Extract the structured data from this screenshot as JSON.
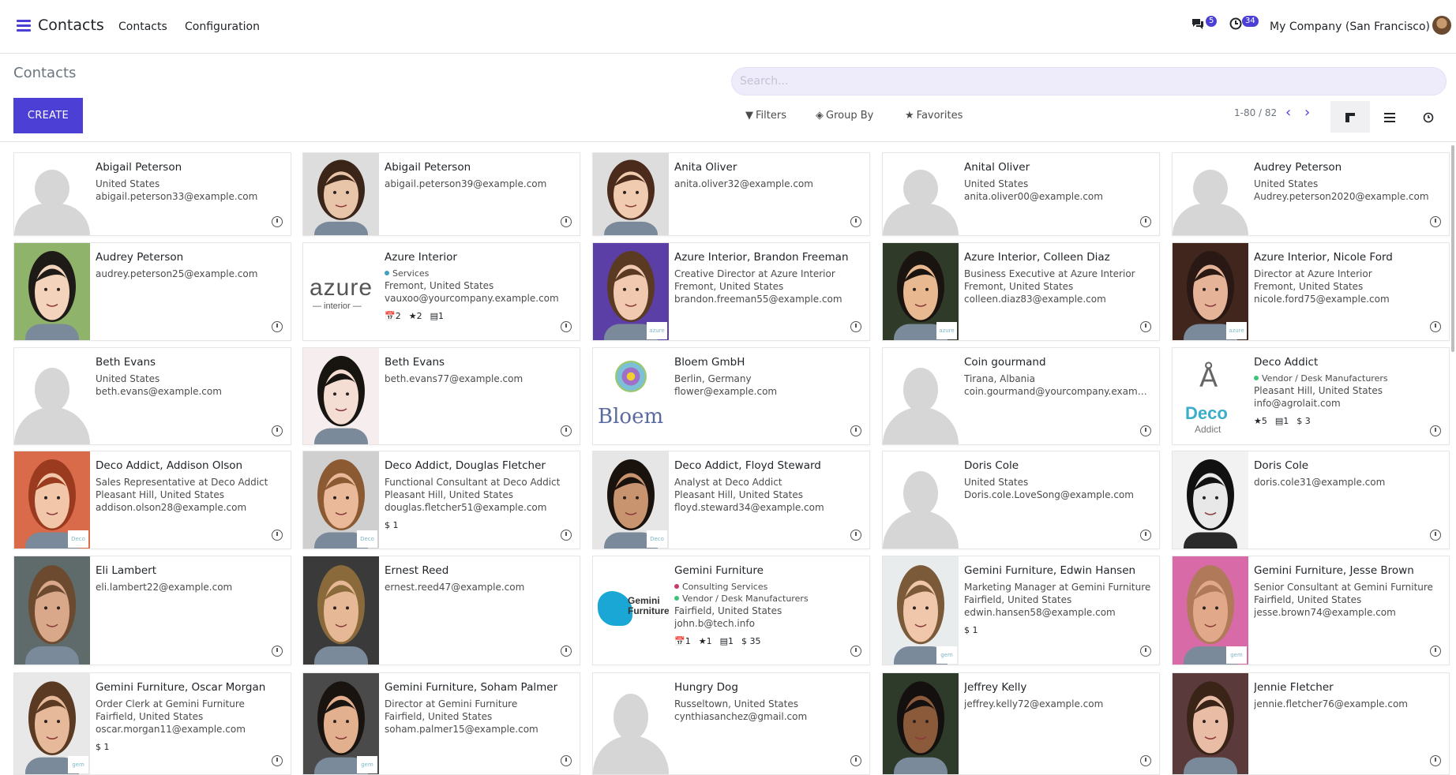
{
  "navbar": {
    "app_name": "Contacts",
    "menu": [
      "Contacts",
      "Configuration"
    ],
    "messages_count": "5",
    "activities_count": "34",
    "company": "My Company (San Francisco)"
  },
  "control_panel": {
    "title": "Contacts",
    "search_placeholder": "Search...",
    "create_label": "CREATE",
    "filters_label": "Filters",
    "groupby_label": "Group By",
    "favorites_label": "Favorites",
    "pager": "1-80 / 82"
  },
  "cards": [
    {
      "name": "Abigail Peterson",
      "lines": [
        "United States",
        "abigail.peterson33@example.com"
      ],
      "photo": "placeholder"
    },
    {
      "name": "Abigail Peterson",
      "lines": [
        "abigail.peterson39@example.com"
      ],
      "photo": "person",
      "skin": "#e8c4a8",
      "hair": "#3b2418"
    },
    {
      "name": "Anita Oliver",
      "lines": [
        "anita.oliver32@example.com"
      ],
      "photo": "person",
      "skin": "#f0cbb0",
      "hair": "#4a2b1c"
    },
    {
      "name": "Anital Oliver",
      "lines": [
        "United States",
        "anita.oliver00@example.com"
      ],
      "photo": "placeholder"
    },
    {
      "name": "Audrey Peterson",
      "lines": [
        "United States",
        "Audrey.peterson2020@example.com"
      ],
      "photo": "placeholder"
    },
    {
      "name": "Audrey Peterson",
      "lines": [
        "audrey.peterson25@example.com"
      ],
      "photo": "person",
      "skin": "#f3d3bb",
      "hair": "#1e1a17",
      "bg": "#8fb36b"
    },
    {
      "name": "Azure Interior",
      "tags": [
        {
          "label": "Services",
          "color": "#3ea3c2"
        }
      ],
      "lines": [
        "Fremont, United States",
        "vauxoo@yourcompany.example.com"
      ],
      "stats": [
        "📅2",
        "★2",
        "▤1"
      ],
      "photo": "logo-azure",
      "logo_text": "azure",
      "logo_sub": "— interior —"
    },
    {
      "name": "Azure Interior, Brandon Freeman",
      "lines": [
        "Creative Director at Azure Interior",
        "Fremont, United States",
        "brandon.freeman55@example.com"
      ],
      "photo": "person",
      "skin": "#f0c9b0",
      "hair": "#5a3a22",
      "bg": "#5b3fa6",
      "badge": "azure"
    },
    {
      "name": "Azure Interior, Colleen Diaz",
      "lines": [
        "Business Executive at Azure Interior",
        "Fremont, United States",
        "colleen.diaz83@example.com"
      ],
      "photo": "person",
      "skin": "#e8b890",
      "hair": "#1a1410",
      "bg": "#2f3b28",
      "badge": "azure"
    },
    {
      "name": "Azure Interior, Nicole Ford",
      "lines": [
        "Director at Azure Interior",
        "Fremont, United States",
        "nicole.ford75@example.com"
      ],
      "photo": "person",
      "skin": "#e5b498",
      "hair": "#2a1814",
      "bg": "#40261c",
      "badge": "azure"
    },
    {
      "name": "Beth Evans",
      "lines": [
        "United States",
        "beth.evans@example.com"
      ],
      "photo": "placeholder"
    },
    {
      "name": "Beth Evans",
      "lines": [
        "beth.evans77@example.com"
      ],
      "photo": "person",
      "skin": "#f4ddd2",
      "hair": "#181410",
      "bg": "#f6eeee"
    },
    {
      "name": "Bloem GmbH",
      "lines": [
        "Berlin, Germany",
        "flower@example.com"
      ],
      "photo": "logo-bloem",
      "logo_text": "Bloem"
    },
    {
      "name": "Coin gourmand",
      "lines": [
        "Tirana, Albania",
        "coin.gourmand@yourcompany.example.com"
      ],
      "photo": "placeholder"
    },
    {
      "name": "Deco Addict",
      "tags": [
        {
          "label": "Vendor / Desk Manufacturers",
          "color": "#3ec27a"
        }
      ],
      "lines": [
        "Pleasant Hill, United States",
        "info@agrolait.com"
      ],
      "stats": [
        "★5",
        "▤1",
        "$ 3"
      ],
      "photo": "logo-deco",
      "logo_text": "Deco",
      "logo_sub": "Addict"
    },
    {
      "name": "Deco Addict, Addison Olson",
      "lines": [
        "Sales Representative at Deco Addict",
        "Pleasant Hill, United States",
        "addison.olson28@example.com"
      ],
      "photo": "person",
      "skin": "#f2c6a8",
      "hair": "#9a3a1e",
      "bg": "#d96a4a",
      "badge": "Deco"
    },
    {
      "name": "Deco Addict, Douglas Fletcher",
      "lines": [
        "Functional Consultant at Deco Addict",
        "Pleasant Hill, United States",
        "douglas.fletcher51@example.com"
      ],
      "stats": [
        "$ 1"
      ],
      "photo": "person",
      "skin": "#e9b99a",
      "hair": "#8b5a32",
      "bg": "#cfcfcf",
      "badge": "Deco"
    },
    {
      "name": "Deco Addict, Floyd Steward",
      "lines": [
        "Analyst at Deco Addict",
        "Pleasant Hill, United States",
        "floyd.steward34@example.com"
      ],
      "photo": "person",
      "skin": "#c89470",
      "hair": "#1a120c",
      "bg": "#e6e6e6",
      "badge": "Deco"
    },
    {
      "name": "Doris Cole",
      "lines": [
        "United States",
        "Doris.cole.LoveSong@example.com"
      ],
      "photo": "placeholder"
    },
    {
      "name": "Doris Cole",
      "lines": [
        "doris.cole31@example.com"
      ],
      "photo": "person",
      "skin": "#e8e8e8",
      "hair": "#111111",
      "bg": "#f2f2f2"
    },
    {
      "name": "Eli Lambert",
      "lines": [
        "eli.lambert22@example.com"
      ],
      "photo": "person",
      "skin": "#d9a88a",
      "hair": "#6b4a30",
      "bg": "#5f6a6a"
    },
    {
      "name": "Ernest Reed",
      "lines": [
        "ernest.reed47@example.com"
      ],
      "photo": "person",
      "skin": "#e7b896",
      "hair": "#8a6a3a",
      "bg": "#3a3a3a"
    },
    {
      "name": "Gemini Furniture",
      "tags": [
        {
          "label": "Consulting Services",
          "color": "#c23e6a"
        },
        {
          "label": "Vendor / Desk Manufacturers",
          "color": "#3ec27a"
        }
      ],
      "lines": [
        "Fairfield, United States",
        "john.b@tech.info"
      ],
      "stats": [
        "📅1",
        "★1",
        "▤1",
        "$ 35"
      ],
      "photo": "logo-gemini",
      "logo_text": "Gemini Furniture"
    },
    {
      "name": "Gemini Furniture, Edwin Hansen",
      "lines": [
        "Marketing Manager at Gemini Furniture",
        "Fairfield, United States",
        "edwin.hansen58@example.com"
      ],
      "stats": [
        "$ 1"
      ],
      "photo": "person",
      "skin": "#f0c7aa",
      "hair": "#7a5a38",
      "bg": "#e8ecec",
      "badge": "gem"
    },
    {
      "name": "Gemini Furniture, Jesse Brown",
      "lines": [
        "Senior Consultant at Gemini Furniture",
        "Fairfield, United States",
        "jesse.brown74@example.com"
      ],
      "photo": "person",
      "skin": "#e2a88a",
      "hair": "#b07a5a",
      "bg": "#d86aa8",
      "badge": "gem"
    },
    {
      "name": "Gemini Furniture, Oscar Morgan",
      "lines": [
        "Order Clerk at Gemini Furniture",
        "Fairfield, United States",
        "oscar.morgan11@example.com"
      ],
      "stats": [
        "$ 1"
      ],
      "photo": "person",
      "skin": "#e6b99a",
      "hair": "#5a3a22",
      "bg": "#e8e8e8",
      "badge": "gem"
    },
    {
      "name": "Gemini Furniture, Soham Palmer",
      "lines": [
        "Director at Gemini Furniture",
        "Fairfield, United States",
        "soham.palmer15@example.com"
      ],
      "photo": "person",
      "skin": "#e2b08e",
      "hair": "#1a1410",
      "bg": "#4a4a4a",
      "badge": "gem"
    },
    {
      "name": "Hungry Dog",
      "lines": [
        "Russeltown, United States",
        "cynthiasanchez@gmail.com"
      ],
      "photo": "placeholder"
    },
    {
      "name": "Jeffrey Kelly",
      "lines": [
        "jeffrey.kelly72@example.com"
      ],
      "photo": "person",
      "skin": "#8a5a3a",
      "hair": "#141010",
      "bg": "#2e3a2a"
    },
    {
      "name": "Jennie Fletcher",
      "lines": [
        "jennie.fletcher76@example.com"
      ],
      "photo": "person",
      "skin": "#e9bca6",
      "hair": "#3a2418",
      "bg": "#5a3a3a"
    }
  ]
}
